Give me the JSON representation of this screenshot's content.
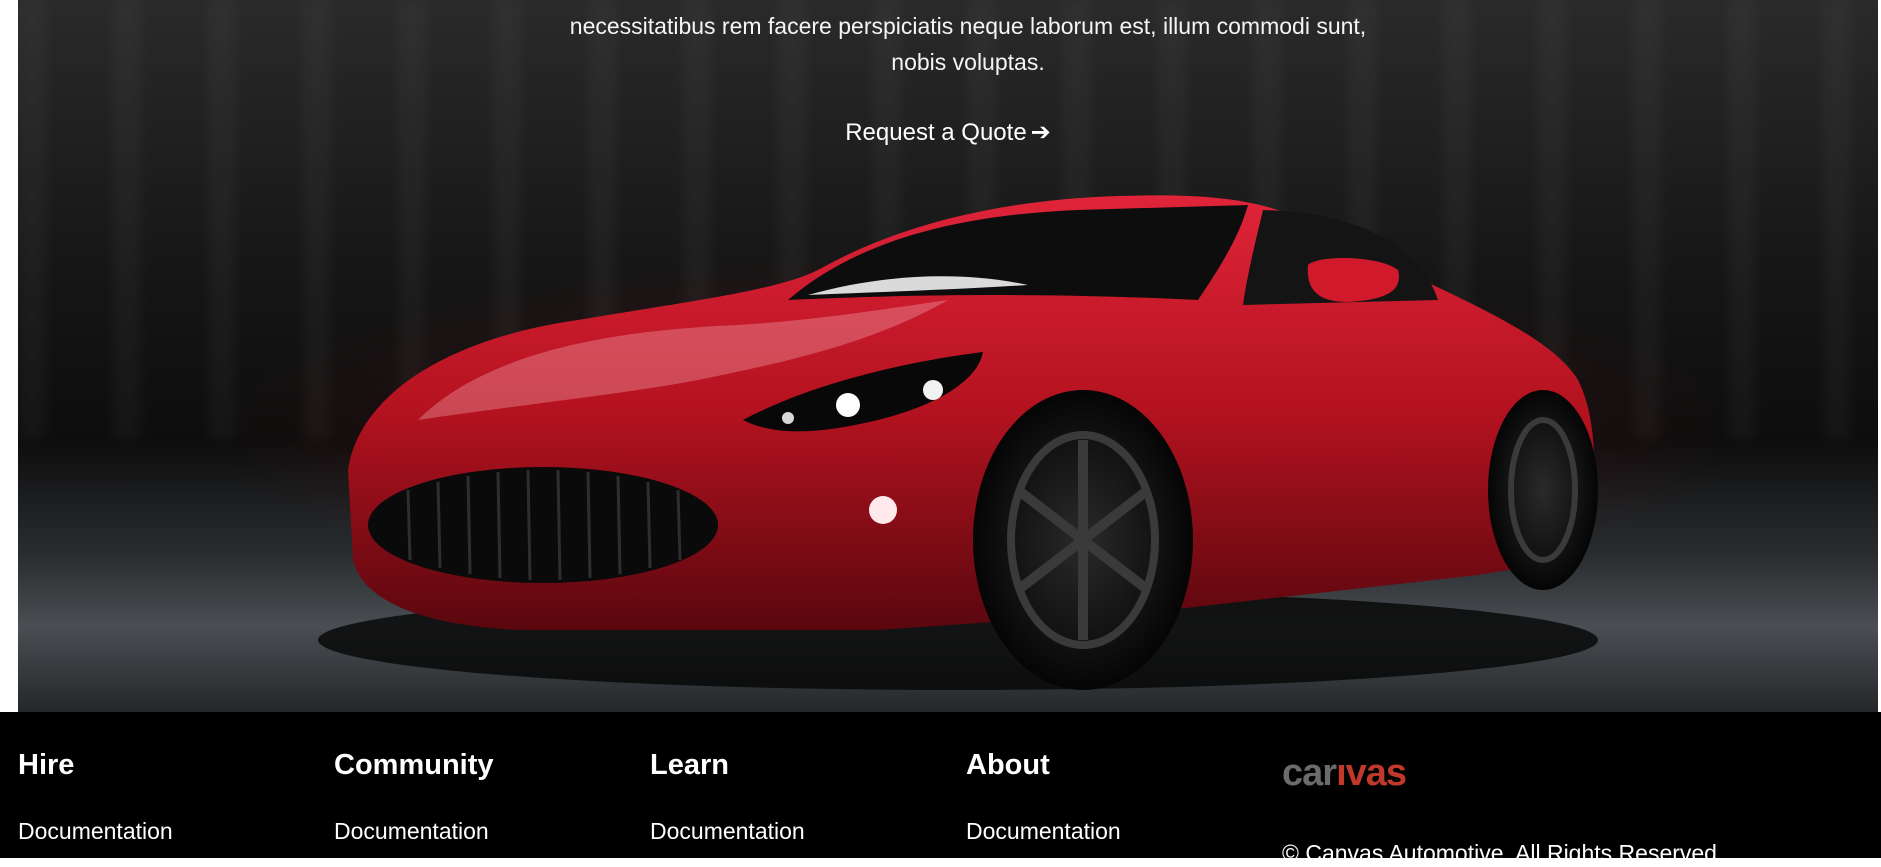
{
  "hero": {
    "text": "necessitatibus rem facere perspiciatis neque laborum est, illum commodi sunt, nobis voluptas.",
    "cta_label": "Request a Quote",
    "cta_icon": "arrow-right-icon",
    "image": "red-sports-car"
  },
  "footer": {
    "columns": [
      {
        "title": "Hire",
        "link": "Documentation"
      },
      {
        "title": "Community",
        "link": "Documentation"
      },
      {
        "title": "Learn",
        "link": "Documentation"
      },
      {
        "title": "About",
        "link": "Documentation"
      }
    ],
    "logo": {
      "part1": "car",
      "part2": "ıvas"
    },
    "copyright": "© Canvas Automotive. All Rights Reserved."
  },
  "colors": {
    "footer_bg": "#000000",
    "car_red": "#b3121f",
    "logo_red": "#c0392b",
    "logo_gray": "#6b6b6b"
  }
}
